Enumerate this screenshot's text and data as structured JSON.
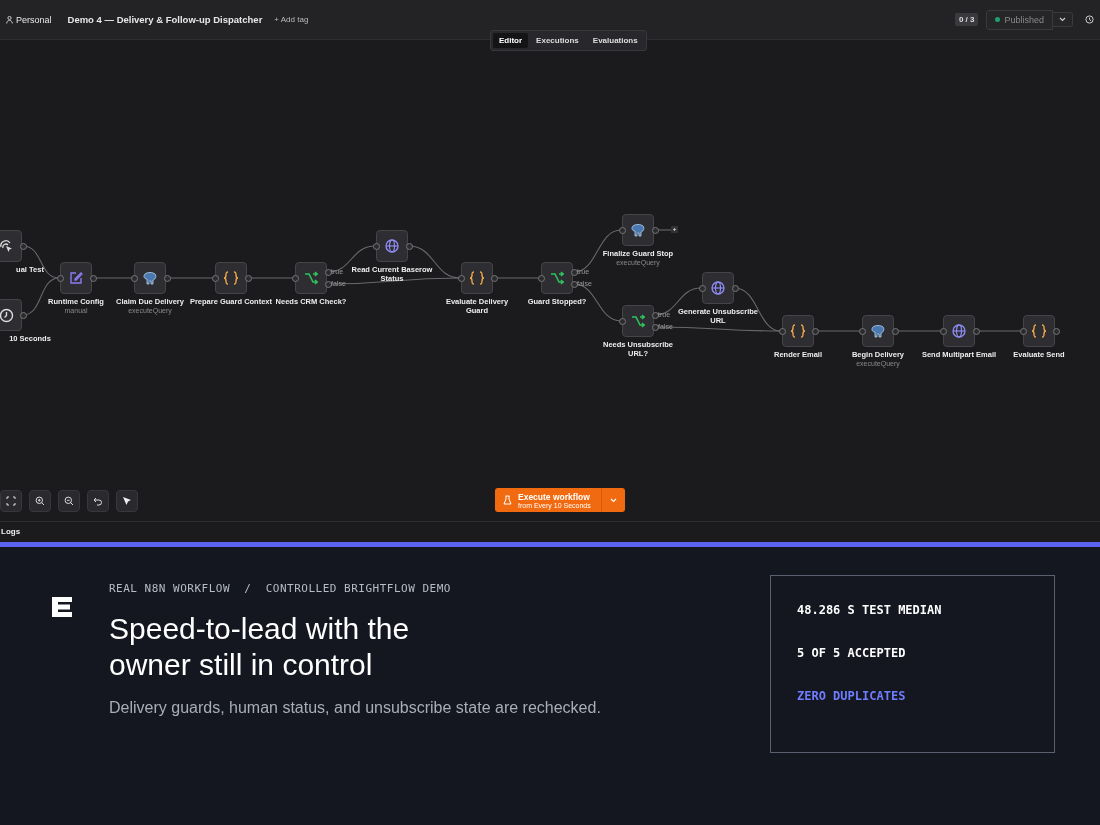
{
  "header": {
    "project": "Personal",
    "title": "Demo 4 — Delivery & Follow-up Dispatcher",
    "add_tag": "+ Add tag",
    "counter": "0 / 3",
    "publish": {
      "label": "Published",
      "disabled": true
    }
  },
  "tabs": [
    {
      "label": "Editor",
      "selected": true
    },
    {
      "label": "Executions",
      "selected": false
    },
    {
      "label": "Evaluations",
      "selected": false
    }
  ],
  "nodes": [
    {
      "kind": "manual",
      "label": "ual Test"
    },
    {
      "kind": "schedule",
      "label": "10 Seconds"
    },
    {
      "kind": "set",
      "label": "Runtime Config",
      "subtitle": "manual"
    },
    {
      "kind": "postgres",
      "label": "Claim Due Delivery",
      "subtitle": "executeQuery"
    },
    {
      "kind": "code",
      "label": "Prepare Guard Context"
    },
    {
      "kind": "if",
      "label": "Needs CRM Check?",
      "outputs": [
        "true",
        "false"
      ]
    },
    {
      "kind": "http",
      "label": "Read Current Baserow Status"
    },
    {
      "kind": "code",
      "label": "Evaluate Delivery Guard"
    },
    {
      "kind": "if",
      "label": "Guard Stopped?",
      "outputs": [
        "true",
        "false"
      ]
    },
    {
      "kind": "postgres",
      "label": "Finalize Guard Stop",
      "subtitle": "executeQuery"
    },
    {
      "kind": "if",
      "label": "Needs Unsubscribe URL?",
      "outputs": [
        "true",
        "false"
      ]
    },
    {
      "kind": "http",
      "label": "Generate Unsubscribe URL"
    },
    {
      "kind": "code",
      "label": "Render Email"
    },
    {
      "kind": "postgres",
      "label": "Begin Delivery",
      "subtitle": "executeQuery"
    },
    {
      "kind": "http",
      "label": "Send Multipart Email"
    },
    {
      "kind": "code",
      "label": "Evaluate Send"
    }
  ],
  "execute": {
    "label": "Execute workflow",
    "sublabel": "from Every 10 Seconds"
  },
  "logs": "Logs",
  "promo": {
    "kicker": "REAL N8N WORKFLOW  /  CONTROLLED BRIGHTFLOW DEMO",
    "headline": "Speed-to-lead with the owner still in control",
    "subline": "Delivery guards, human status, and unsubscribe state are rechecked.",
    "stats": [
      {
        "text": "48.286 S TEST MEDIAN",
        "color": "#ffffff"
      },
      {
        "text": "5 OF 5 ACCEPTED",
        "color": "#ffffff"
      },
      {
        "text": "ZERO DUPLICATES",
        "color": "#6f7dff"
      }
    ]
  }
}
